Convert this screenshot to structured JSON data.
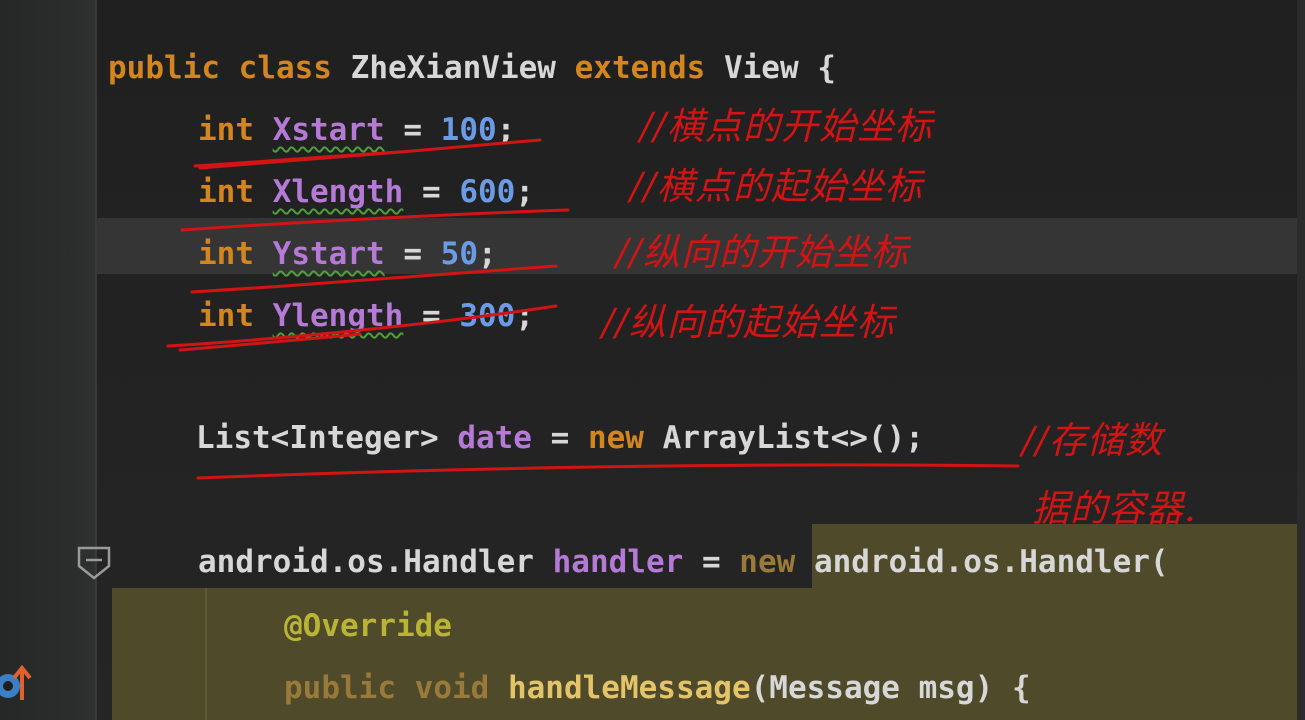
{
  "code": {
    "class_decl": {
      "kw_public": "public",
      "kw_class": "class",
      "name": "ZheXianView",
      "kw_extends": "extends",
      "parent": "View",
      "brace": "{"
    },
    "fields": [
      {
        "type": "int",
        "name": "Xstart",
        "eq": "=",
        "value": "100",
        "semi": ";"
      },
      {
        "type": "int",
        "name": "Xlength",
        "eq": "=",
        "value": "600",
        "semi": ";"
      },
      {
        "type": "int",
        "name": "Ystart",
        "eq": "=",
        "value": "50",
        "semi": ";"
      },
      {
        "type": "int",
        "name": "Ylength",
        "eq": "=",
        "value": "300",
        "semi": ";"
      }
    ],
    "list_line": {
      "type": "List<Integer>",
      "name": "date",
      "eq": "=",
      "kw_new": "new",
      "ctor": "ArrayList<>();"
    },
    "handler_line": {
      "type": "android.os.Handler",
      "name": "handler",
      "eq": "=",
      "kw_new": "new",
      "ctor": "android.os.Handler("
    },
    "override_line": "@Override",
    "method_line": {
      "kw_public": "public",
      "kw_void": "void",
      "name": "handleMessage",
      "params": "(Message msg)",
      "brace": "{"
    }
  },
  "annotations": [
    "//横点的开始坐标",
    "//横点的起始坐标",
    "//纵向的开始坐标",
    "//纵向的起始坐标",
    "//存储数",
    "据的容器."
  ],
  "colors": {
    "keyword": "#d3861f",
    "field": "#b57ad6",
    "number": "#6c9be6",
    "annotation": "#b9b336",
    "ink": "#d21414",
    "highlight": "#4e4a2a"
  },
  "icons": {
    "fold": "fold-marker-icon",
    "gutter": "override-arrow-icon"
  }
}
